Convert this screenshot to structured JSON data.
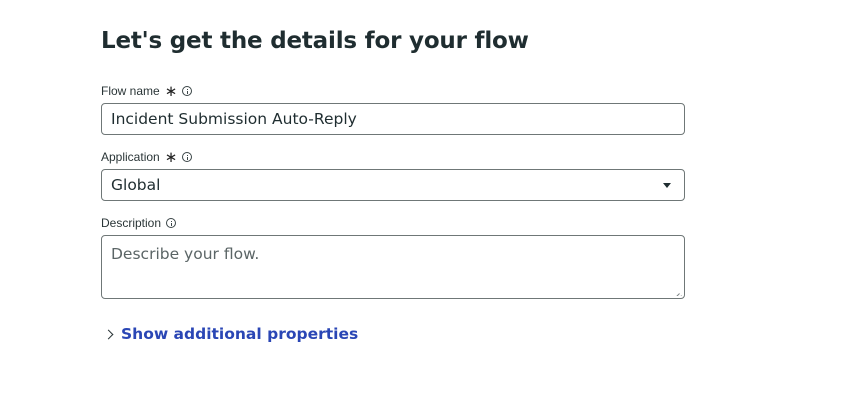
{
  "page": {
    "title": "Let's get the details for your flow"
  },
  "fields": {
    "flow_name": {
      "label": "Flow name",
      "required_mark": "∗",
      "value": "Incident Submission Auto-Reply"
    },
    "application": {
      "label": "Application",
      "required_mark": "∗",
      "selected": "Global"
    },
    "description": {
      "label": "Description",
      "placeholder": "Describe your flow."
    }
  },
  "links": {
    "show_additional": "Show additional properties"
  },
  "icons": {
    "info": "info-icon",
    "dropdown": "caret-down-icon",
    "expand": "chevron-right-icon"
  },
  "colors": {
    "link": "#2a46b5",
    "text": "#1f2d30",
    "border": "#6f7777"
  }
}
